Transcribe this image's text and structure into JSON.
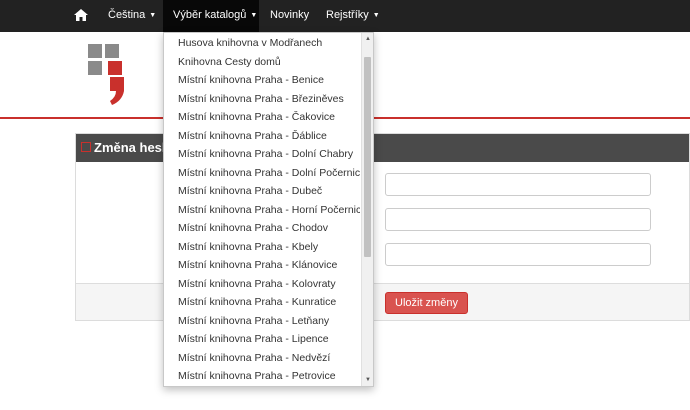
{
  "navbar": {
    "home_icon": "home-icon",
    "language_label": "Čeština",
    "catalog_label": "Výběr katalogů",
    "news_label": "Novinky",
    "registry_label": "Rejstříky",
    "caret": "▼"
  },
  "colors": {
    "navbar_bg": "#222222",
    "accent_red": "#c9302c",
    "panel_heading_bg": "#4a4a4a"
  },
  "panel": {
    "title": "Změna hesla"
  },
  "form": {
    "save_label": "Uložit změny"
  },
  "dropdown": {
    "items": [
      "Husova knihovna v Modřanech",
      "Knihovna Cesty domů",
      "Místní knihovna Praha - Benice",
      "Místní knihovna Praha - Březiněves",
      "Místní knihovna Praha - Čakovice",
      "Místní knihovna Praha - Ďáblice",
      "Místní knihovna Praha - Dolní Chabry",
      "Místní knihovna Praha - Dolní Počernice",
      "Místní knihovna Praha - Dubeč",
      "Místní knihovna Praha - Horní Počernice",
      "Místní knihovna Praha - Chodov",
      "Místní knihovna Praha - Kbely",
      "Místní knihovna Praha - Klánovice",
      "Místní knihovna Praha - Kolovraty",
      "Místní knihovna Praha - Kunratice",
      "Místní knihovna Praha - Letňany",
      "Místní knihovna Praha - Lipence",
      "Místní knihovna Praha - Nedvězí",
      "Místní knihovna Praha - Petrovice"
    ],
    "scroll_up": "▲",
    "scroll_down": "▼"
  }
}
